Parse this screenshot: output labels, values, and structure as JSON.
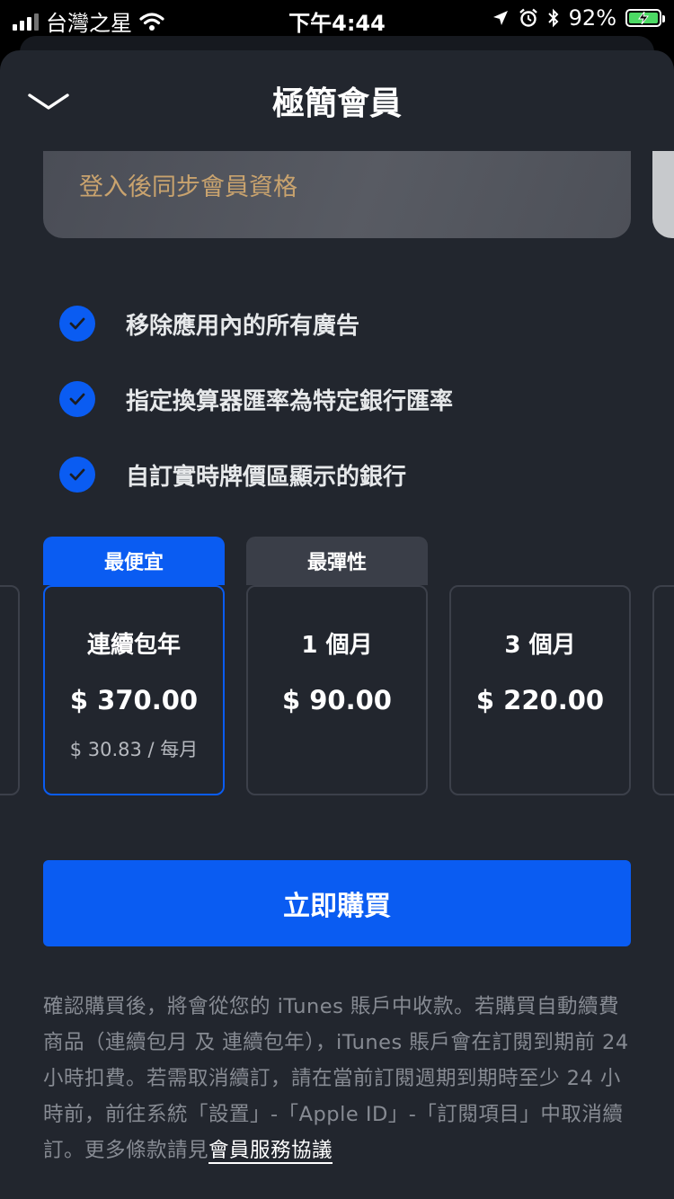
{
  "status_bar": {
    "carrier": "台灣之星",
    "time": "下午4:44",
    "battery": "92%"
  },
  "sheet": {
    "title": "極簡會員",
    "banner_text": "登入後同步會員資格"
  },
  "features": [
    {
      "label": "移除應用內的所有廣告"
    },
    {
      "label": "指定換算器匯率為特定銀行匯率"
    },
    {
      "label": "自訂實時牌價區顯示的銀行"
    }
  ],
  "plans": [
    {
      "tag": "最便宜",
      "name": "連續包年",
      "price": "$ 370.00",
      "per_month": "$ 30.83 / 每月",
      "selected": true
    },
    {
      "tag": "最彈性",
      "name": "1 個月",
      "price": "$ 90.00"
    },
    {
      "name": "3 個月",
      "price": "$ 220.00"
    }
  ],
  "buy_button": "立即購買",
  "disclaimer": {
    "text": "確認購買後，將會從您的 iTunes 賬戶中收款。若購買自動續費商品（連續包月 及 連續包年），iTunes 賬戶會在訂閱到期前 24 小時扣費。若需取消續訂，請在當前訂閱週期到期時至少 24 小時前，前往系統「設置」-「Apple ID」-「訂閱項目」中取消續訂。更多條款請見",
    "link": "會員服務協議"
  },
  "colors": {
    "accent": "#0a5cf2",
    "sheet_bg": "#22262e",
    "banner_text": "#c9a36e"
  }
}
